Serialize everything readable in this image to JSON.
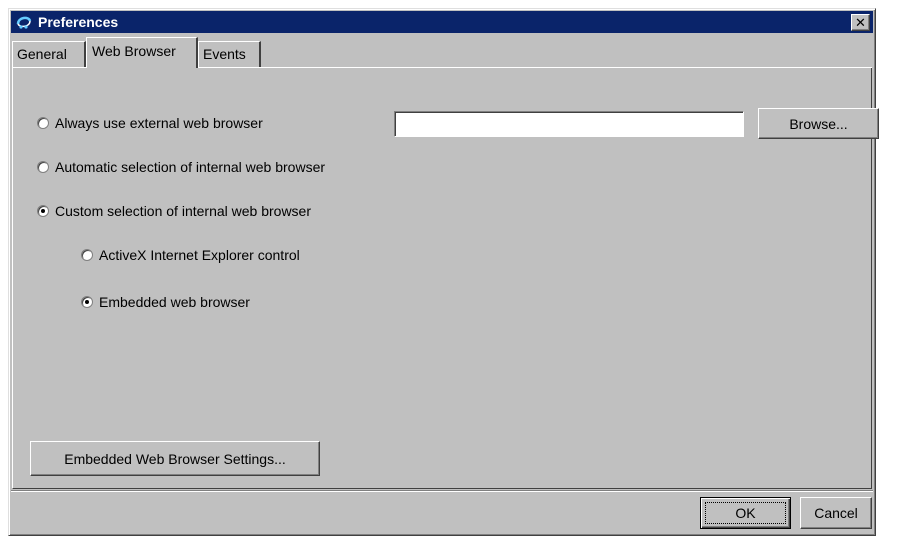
{
  "window": {
    "title": "Preferences",
    "close_glyph": "✕",
    "icon": "app-logo-icon"
  },
  "tabs": [
    {
      "label": "General",
      "active": false
    },
    {
      "label": "Web Browser",
      "active": true
    },
    {
      "label": "Events",
      "active": false
    }
  ],
  "options": {
    "external": {
      "label": "Always use external web browser",
      "checked": false
    },
    "automatic": {
      "label": "Automatic selection of internal web browser",
      "checked": false
    },
    "custom": {
      "label": "Custom selection of internal web browser",
      "checked": true
    },
    "activex": {
      "label": "ActiveX Internet Explorer control",
      "checked": false
    },
    "embedded": {
      "label": "Embedded web browser",
      "checked": true
    }
  },
  "browser_path": {
    "value": ""
  },
  "buttons": {
    "browse": "Browse...",
    "embedded_settings": "Embedded Web Browser Settings...",
    "ok": "OK",
    "cancel": "Cancel"
  },
  "colors": {
    "titlebar": "#0a246a",
    "face": "#c0c0c0"
  }
}
